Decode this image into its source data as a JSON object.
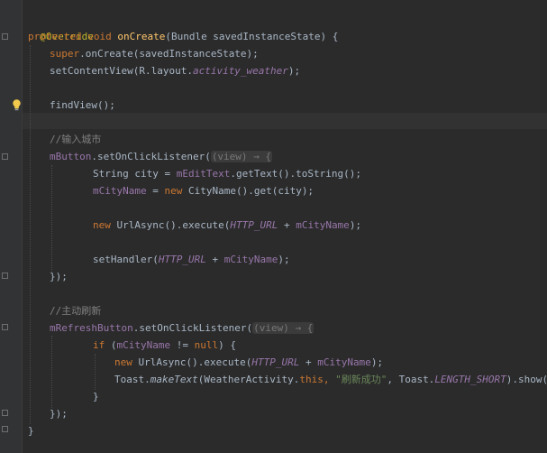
{
  "editor": {
    "lines": {
      "l1": "@Override",
      "l2_kw": "protected void ",
      "l2_name": "onCreate",
      "l2_rest": "(Bundle savedInstanceState) {",
      "l3_kw": "super",
      "l3_rest": ".onCreate(savedInstanceState);",
      "l4_a": "setContentView(R.layout.",
      "l4_b": "activity_weather",
      "l4_c": ");",
      "l5": "findView();",
      "l6": "//输入城市",
      "l7_a": "mButton",
      "l7_b": ".setOnClickListener(",
      "l7_hint": "(view) → {",
      "l8_a": "String city = ",
      "l8_b": "mEditText",
      "l8_c": ".getText().toString();",
      "l9_a": "mCityName",
      "l9_b": " = ",
      "l9_c": "new ",
      "l9_d": "CityName().get(city);",
      "l10_a": "new ",
      "l10_b": "UrlAsync().execute(",
      "l10_c": "HTTP_URL",
      "l10_d": " + ",
      "l10_e": "mCityName",
      "l10_f": ");",
      "l11_a": "setHandler(",
      "l11_b": "HTTP_URL",
      "l11_c": " + ",
      "l11_d": "mCityName",
      "l11_e": ");",
      "l12": "});",
      "l13": "//主动刷新",
      "l14_a": "mRefreshButton",
      "l14_b": ".setOnClickListener(",
      "l14_hint": "(view) → {",
      "l15_a": "if ",
      "l15_b": "(",
      "l15_c": "mCityName",
      "l15_d": " != ",
      "l15_e": "null",
      "l15_f": ") {",
      "l16_a": "new ",
      "l16_b": "UrlAsync().execute(",
      "l16_c": "HTTP_URL",
      "l16_d": " + ",
      "l16_e": "mCityName",
      "l16_f": ");",
      "l17_a": "Toast.",
      "l17_b": "makeText",
      "l17_c": "(WeatherActivity.",
      "l17_d": "this",
      "l17_e": ", ",
      "l17_f": "\"刷新成功\"",
      "l17_g": ", Toast.",
      "l17_h": "LENGTH_SHORT",
      "l17_i": ").show();",
      "l18": "}",
      "l19": "});",
      "l20": "}"
    }
  }
}
